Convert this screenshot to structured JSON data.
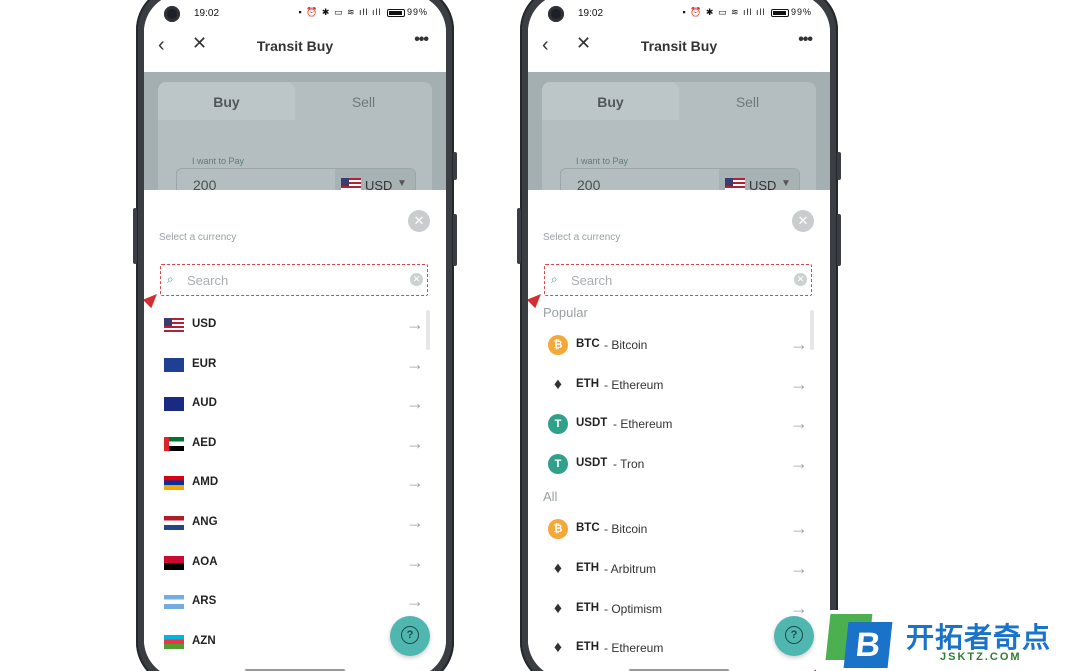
{
  "status": {
    "time": "19:02",
    "battery": "99%"
  },
  "app": {
    "title": "Transit Buy"
  },
  "trade": {
    "tab_buy": "Buy",
    "tab_sell": "Sell",
    "pay_label": "I want to Pay",
    "pay_value": "200",
    "pay_currency": "USD"
  },
  "sheet": {
    "label": "Select a currency",
    "search_placeholder": "Search"
  },
  "left_list": [
    {
      "code": "USD",
      "flag": "flag-us"
    },
    {
      "code": "EUR",
      "flag": "flag-eu"
    },
    {
      "code": "AUD",
      "flag": "flag-au"
    },
    {
      "code": "AED",
      "flag": "flag-ae"
    },
    {
      "code": "AMD",
      "flag": "flag-am"
    },
    {
      "code": "ANG",
      "flag": "flag-ang"
    },
    {
      "code": "AOA",
      "flag": "flag-ao"
    },
    {
      "code": "ARS",
      "flag": "flag-ar"
    },
    {
      "code": "AZN",
      "flag": "flag-az"
    }
  ],
  "right_list": {
    "popular_title": "Popular",
    "popular": [
      {
        "code": "BTC",
        "name": "- Bitcoin",
        "icon": "btc"
      },
      {
        "code": "ETH",
        "name": "- Ethereum",
        "icon": "eth"
      },
      {
        "code": "USDT",
        "name": "- Ethereum",
        "icon": "usdt"
      },
      {
        "code": "USDT",
        "name": "- Tron",
        "icon": "usdt"
      }
    ],
    "all_title": "All",
    "all": [
      {
        "code": "BTC",
        "name": "- Bitcoin",
        "icon": "btc"
      },
      {
        "code": "ETH",
        "name": "- Arbitrum",
        "icon": "eth"
      },
      {
        "code": "ETH",
        "name": "- Optimism",
        "icon": "eth"
      },
      {
        "code": "ETH",
        "name": "- Ethereum",
        "icon": "eth"
      }
    ]
  },
  "watermark": {
    "cn": "开拓者奇点",
    "en": "JSKTZ.COM",
    "logo_letter": "B"
  },
  "colors": {
    "accent": "#4fb6b0",
    "search_border": "#d8454a",
    "overlay": "#a4afb2"
  }
}
